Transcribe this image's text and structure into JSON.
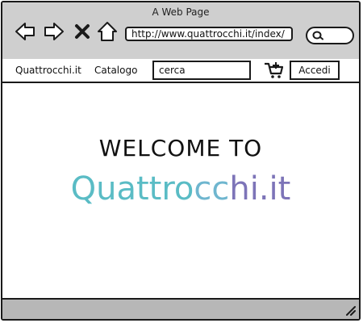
{
  "window": {
    "title": "A Web Page"
  },
  "toolbar": {
    "url": "http://www.quattrocchi.it/index/",
    "icons": [
      "back-arrow-icon",
      "forward-arrow-icon",
      "close-icon",
      "home-icon",
      "search-icon"
    ]
  },
  "menu": {
    "brand": "Quattrocchi.it",
    "catalog": "Catalogo",
    "search_value": "cerca",
    "cart_icon": "cart-icon",
    "login_label": "Accedi"
  },
  "main": {
    "welcome": "WELCOME TO",
    "logo": {
      "part1": "Quattro",
      "part2": "cc",
      "part3": "hi.it"
    }
  },
  "colors": {
    "chrome": "#cfcfcf",
    "statusbar": "#b7b7b7",
    "logo_teal": "#5abcc5",
    "logo_purple": "#7d74b8"
  }
}
